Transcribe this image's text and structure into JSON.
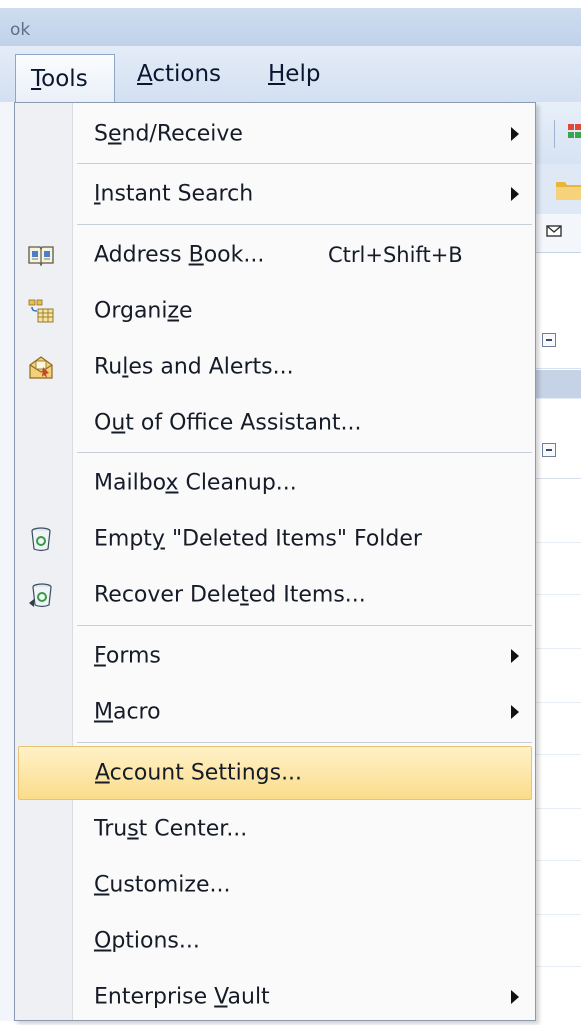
{
  "window": {
    "title_fragment": "ok"
  },
  "menubar": {
    "items": [
      {
        "label_underlined": "T",
        "label_rest": "ools"
      },
      {
        "label_underlined": "A",
        "label_rest": "ctions"
      },
      {
        "label_underlined": "H",
        "label_rest": "elp"
      }
    ]
  },
  "menu": {
    "items": [
      {
        "pre": "S",
        "u": "e",
        "post": "nd/Receive",
        "submenu": true
      },
      {
        "pre": "",
        "u": "I",
        "post": "nstant Search",
        "submenu": true
      },
      {
        "pre": "Address ",
        "u": "B",
        "post": "ook...",
        "shortcut": "Ctrl+Shift+B",
        "icon": "address-book-icon"
      },
      {
        "pre": "Organi",
        "u": "z",
        "post": "e",
        "icon": "organize-icon"
      },
      {
        "pre": "Ru",
        "u": "l",
        "post": "es and Alerts...",
        "icon": "rules-alerts-icon"
      },
      {
        "pre": "O",
        "u": "u",
        "post": "t of Office Assistant..."
      },
      {
        "pre": "Mailbo",
        "u": "x",
        "post": " Cleanup..."
      },
      {
        "pre": "Empt",
        "u": "y",
        "post": " \"Deleted Items\" Folder",
        "icon": "recycle-bin-icon"
      },
      {
        "pre": "Recover Dele",
        "u": "t",
        "post": "ed Items...",
        "icon": "recover-bin-icon"
      },
      {
        "pre": "",
        "u": "F",
        "post": "orms",
        "submenu": true
      },
      {
        "pre": "",
        "u": "M",
        "post": "acro",
        "submenu": true
      },
      {
        "pre": "",
        "u": "A",
        "post": "ccount Settings...",
        "highlighted": true
      },
      {
        "pre": "Tru",
        "u": "s",
        "post": "t Center..."
      },
      {
        "pre": "",
        "u": "C",
        "post": "ustomize..."
      },
      {
        "pre": "",
        "u": "O",
        "post": "ptions..."
      },
      {
        "pre": "Enterprise ",
        "u": "V",
        "post": "ault",
        "submenu": true
      }
    ]
  },
  "colors": {
    "highlight": "#fbdc8b",
    "menubar": "#d3e0f1",
    "gutter": "#eef0f3"
  }
}
